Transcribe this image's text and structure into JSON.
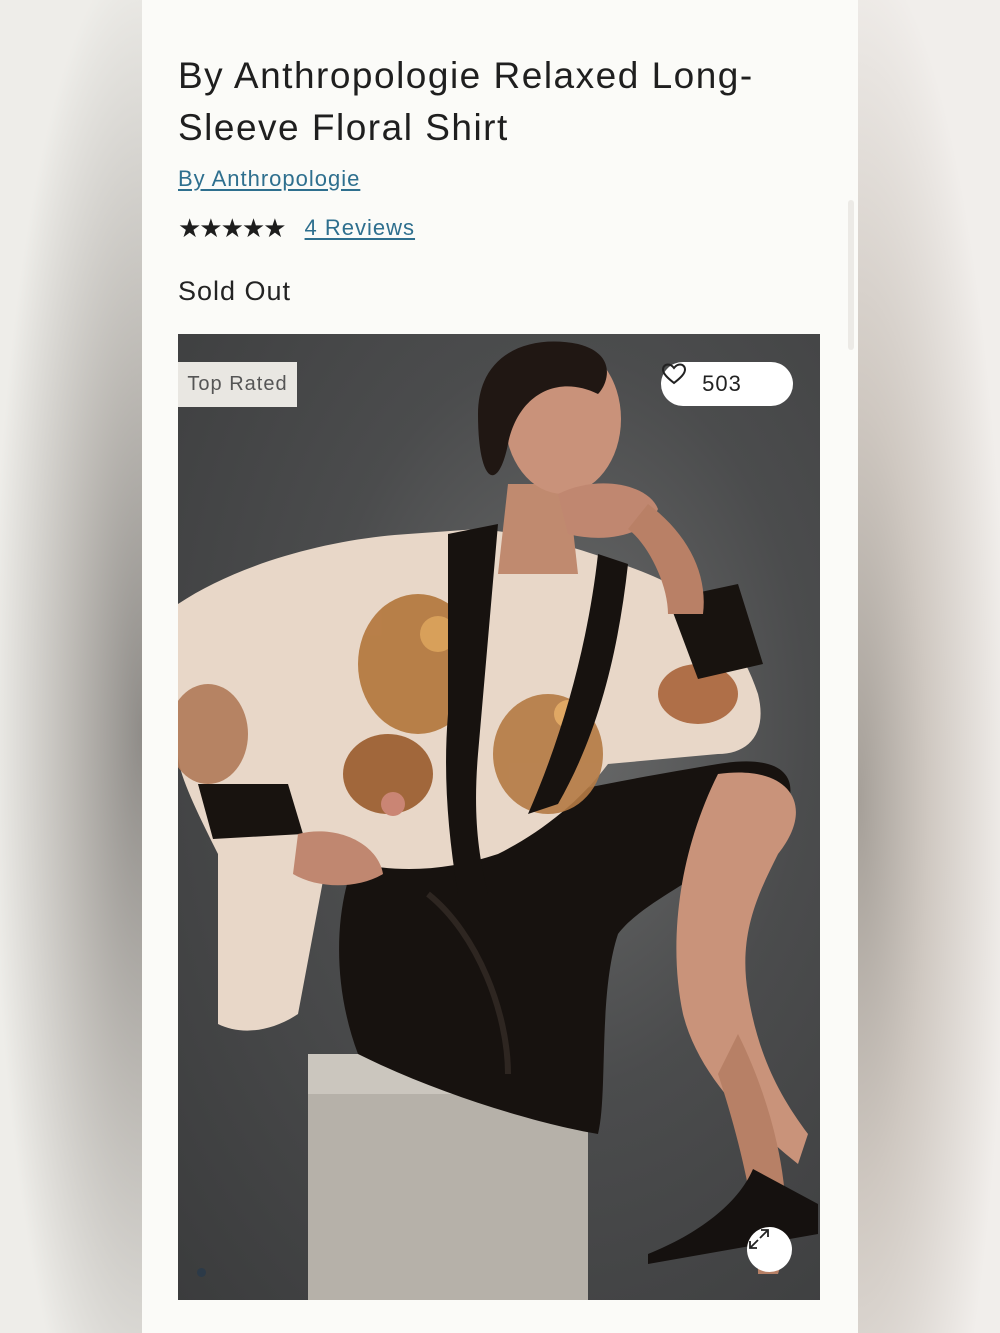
{
  "product": {
    "title": "By Anthropologie Relaxed Long-Sleeve Floral Shirt",
    "brand": "By Anthropologie",
    "rating_stars": "★★★★★",
    "rating": 5,
    "reviews_label": "4 Reviews",
    "status": "Sold Out"
  },
  "image": {
    "badge": "Top Rated",
    "favorites_count": "503",
    "carousel_current": 1
  },
  "icons": {
    "favorite": "heart-icon",
    "expand": "expand-icon"
  },
  "colors": {
    "link": "#2e6f8e",
    "text": "#1f1f1f",
    "page_bg": "#fbfbf8"
  }
}
